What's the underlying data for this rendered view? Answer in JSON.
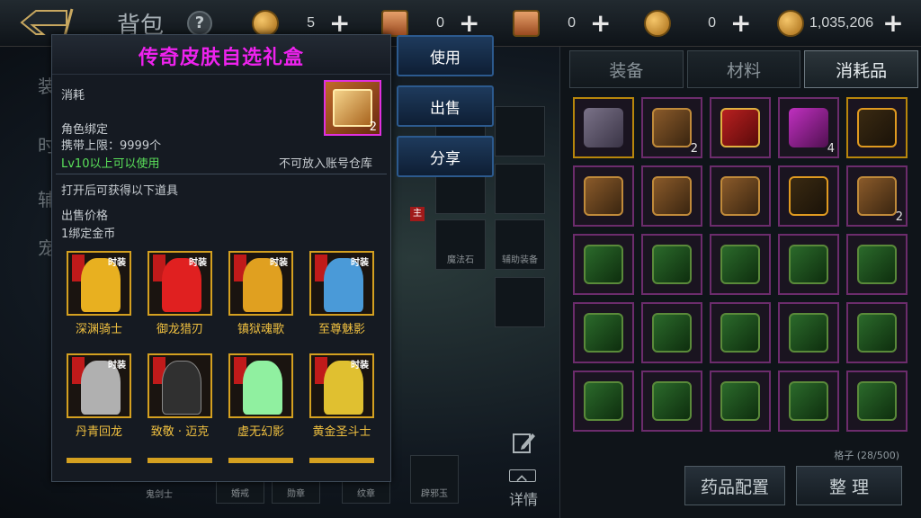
{
  "topbar": {
    "title": "背包",
    "help": "?",
    "currencies": [
      {
        "icon": "gold-coin-icon",
        "value": "5"
      },
      {
        "icon": "scroll-icon",
        "value": "0"
      },
      {
        "icon": "token-icon",
        "value": "0"
      },
      {
        "icon": "gold-sack-icon",
        "value": "1,035,206"
      }
    ]
  },
  "left_tabs": [
    "装",
    "时",
    "辅",
    "宠"
  ],
  "inventory": {
    "tabs": [
      "装备",
      "材料",
      "消耗品"
    ],
    "active_tab": "消耗品",
    "slot_counts": [
      "",
      "2",
      "",
      "4",
      "",
      "",
      "",
      "",
      "",
      "2"
    ],
    "capacity": "格子 (28/500)",
    "buttons": [
      "药品配置",
      "整 理"
    ]
  },
  "middle": {
    "slots": [
      "魔法石",
      "辅助装备"
    ],
    "bottom_slots": [
      "鬼剑士",
      "婚戒",
      "勋章",
      "纹章",
      "辟邪玉"
    ],
    "details": "详情",
    "main_tag": "主"
  },
  "popup": {
    "title": "传奇皮肤自选礼盒",
    "category": "消耗",
    "bind": "角色绑定",
    "carry_limit": "携带上限：9999个",
    "level_req": "Lv10以上可以使用",
    "storage_note": "不可放入账号仓库",
    "item_count": "2",
    "open_desc": "打开后可获得以下道具",
    "sell_label": "出售价格",
    "sell_value": "1绑定金币",
    "rewards": [
      {
        "name": "深渊骑士",
        "size": "时装",
        "color": "#e8b020"
      },
      {
        "name": "御龙猎刃",
        "size": "时装",
        "color": "#e02020"
      },
      {
        "name": "镇狱魂歌",
        "size": "时装",
        "color": "#e0a020"
      },
      {
        "name": "至尊魅影",
        "size": "时装",
        "color": "#4a9ad8"
      },
      {
        "name": "丹青回龙",
        "size": "时装",
        "color": "#b0b0b0"
      },
      {
        "name": "致敬 · 迈克",
        "size": "",
        "color": "#303030"
      },
      {
        "name": "虚无幻影",
        "size": "",
        "color": "#90f0a0"
      },
      {
        "name": "黄金圣斗士",
        "size": "时装",
        "color": "#e0c030"
      }
    ]
  },
  "actions": [
    "使用",
    "出售",
    "分享"
  ]
}
